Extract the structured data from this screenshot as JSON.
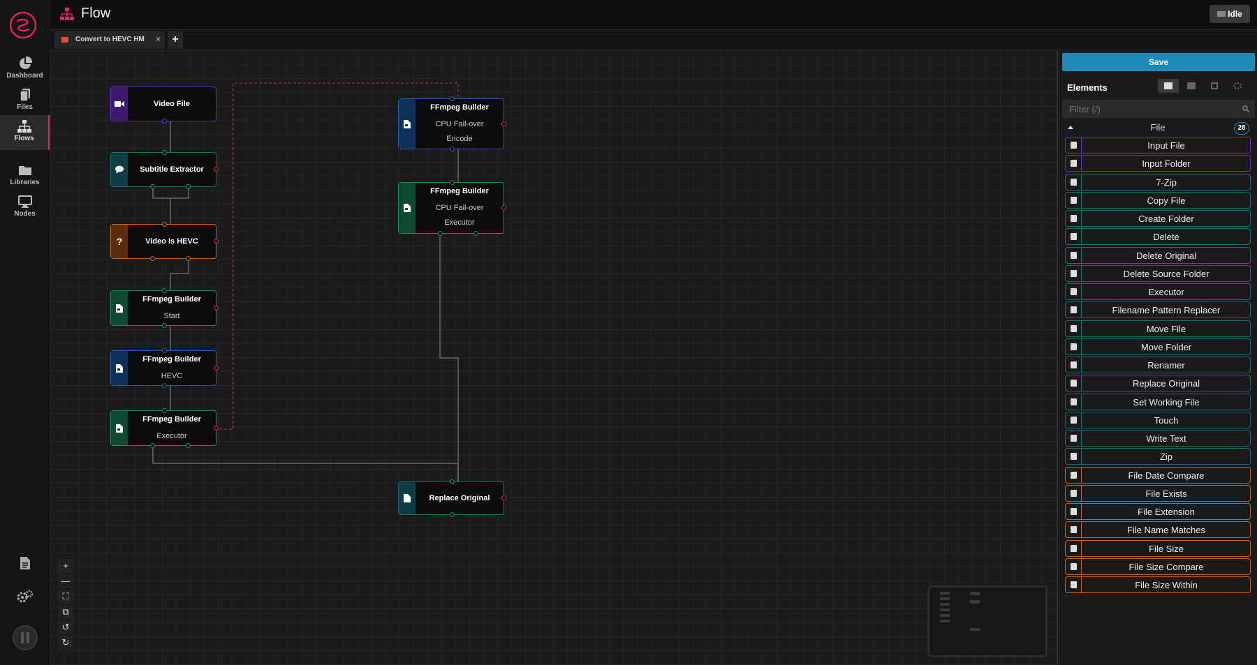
{
  "app": {
    "title": "Flow",
    "status": "Idle"
  },
  "nav": {
    "items": [
      {
        "label": "Dashboard"
      },
      {
        "label": "Files"
      },
      {
        "label": "Flows"
      },
      {
        "label": "Libraries"
      },
      {
        "label": "Nodes"
      }
    ]
  },
  "tabs": {
    "active_label": "Convert to HEVC HM",
    "close": "×",
    "add": "+"
  },
  "flow": {
    "nodes": {
      "video_file": {
        "title": "Video File"
      },
      "subtitle_extractor": {
        "title": "Subtitle Extractor"
      },
      "video_is_hevc": {
        "title": "Video Is HEVC"
      },
      "ffmpeg_start": {
        "title": "FFmpeg Builder",
        "subtitle": "Start"
      },
      "ffmpeg_hevc": {
        "title": "FFmpeg Builder",
        "subtitle": "HEVC"
      },
      "ffmpeg_executor": {
        "title": "FFmpeg Builder",
        "subtitle": "Executor"
      },
      "ffmpeg_cpu_encode": {
        "title": "FFmpeg Builder",
        "subtitle1": "CPU Fail-over",
        "subtitle2": "Encode"
      },
      "ffmpeg_cpu_executor": {
        "title": "FFmpeg Builder",
        "subtitle1": "CPU Fail-over",
        "subtitle2": "Executor"
      },
      "replace_original": {
        "title": "Replace Original"
      }
    }
  },
  "zoom_controls": [
    "+",
    "—",
    "⛶",
    "⧉",
    "↺",
    "↻"
  ],
  "panel": {
    "save_label": "Save",
    "elements_title": "Elements",
    "filter_placeholder": "Filter (/)",
    "group": {
      "name": "File",
      "count": "28"
    },
    "items": [
      {
        "label": "Input File",
        "color": "#6c2bd9",
        "icon": "file-icon"
      },
      {
        "label": "Input Folder",
        "color": "#6c2bd9",
        "icon": "folder-icon"
      },
      {
        "label": "7-Zip",
        "color": "#1a6b78",
        "icon": "archive-icon"
      },
      {
        "label": "Copy File",
        "color": "#1a6b78",
        "icon": "copy-icon"
      },
      {
        "label": "Create Folder",
        "color": "#1a6b78",
        "icon": "folder-icon"
      },
      {
        "label": "Delete",
        "color": "#1a6b78",
        "icon": "trash-icon"
      },
      {
        "label": "Delete Original",
        "color": "#1a6b78",
        "icon": "trash-icon"
      },
      {
        "label": "Delete Source Folder",
        "color": "#1a6b78",
        "icon": "trash-icon"
      },
      {
        "label": "Executor",
        "color": "#1a6b78",
        "icon": "terminal-icon"
      },
      {
        "label": "Filename Pattern Replacer",
        "color": "#1a6b78",
        "icon": "swap-icon"
      },
      {
        "label": "Move File",
        "color": "#1a6b78",
        "icon": "file-move-icon"
      },
      {
        "label": "Move Folder",
        "color": "#1a6b78",
        "icon": "folder-move-icon"
      },
      {
        "label": "Renamer",
        "color": "#1a6b78",
        "icon": "font-icon"
      },
      {
        "label": "Replace Original",
        "color": "#1a6b78",
        "icon": "file-icon"
      },
      {
        "label": "Set Working File",
        "color": "#1a6b78",
        "icon": "file-icon"
      },
      {
        "label": "Touch",
        "color": "#1a6b78",
        "icon": "hand-icon"
      },
      {
        "label": "Write Text",
        "color": "#1a6b78",
        "icon": "edit-icon"
      },
      {
        "label": "Zip",
        "color": "#1a6b78",
        "icon": "zip-icon"
      },
      {
        "label": "File Date Compare",
        "color": "#c0661e",
        "icon": "calendar-icon"
      },
      {
        "label": "File Exists",
        "color": "#c0661e",
        "icon": "question-icon"
      },
      {
        "label": "File Extension",
        "color": "#c0661e",
        "icon": "file-code-icon"
      },
      {
        "label": "File Name Matches",
        "color": "#c0661e",
        "icon": "equals-icon"
      },
      {
        "label": "File Size",
        "color": "#c0661e",
        "icon": "scale-icon"
      },
      {
        "label": "File Size Compare",
        "color": "#c0661e",
        "icon": "sitemap-icon"
      },
      {
        "label": "File Size Within",
        "color": "#c0661e",
        "icon": "scale-icon"
      }
    ]
  }
}
